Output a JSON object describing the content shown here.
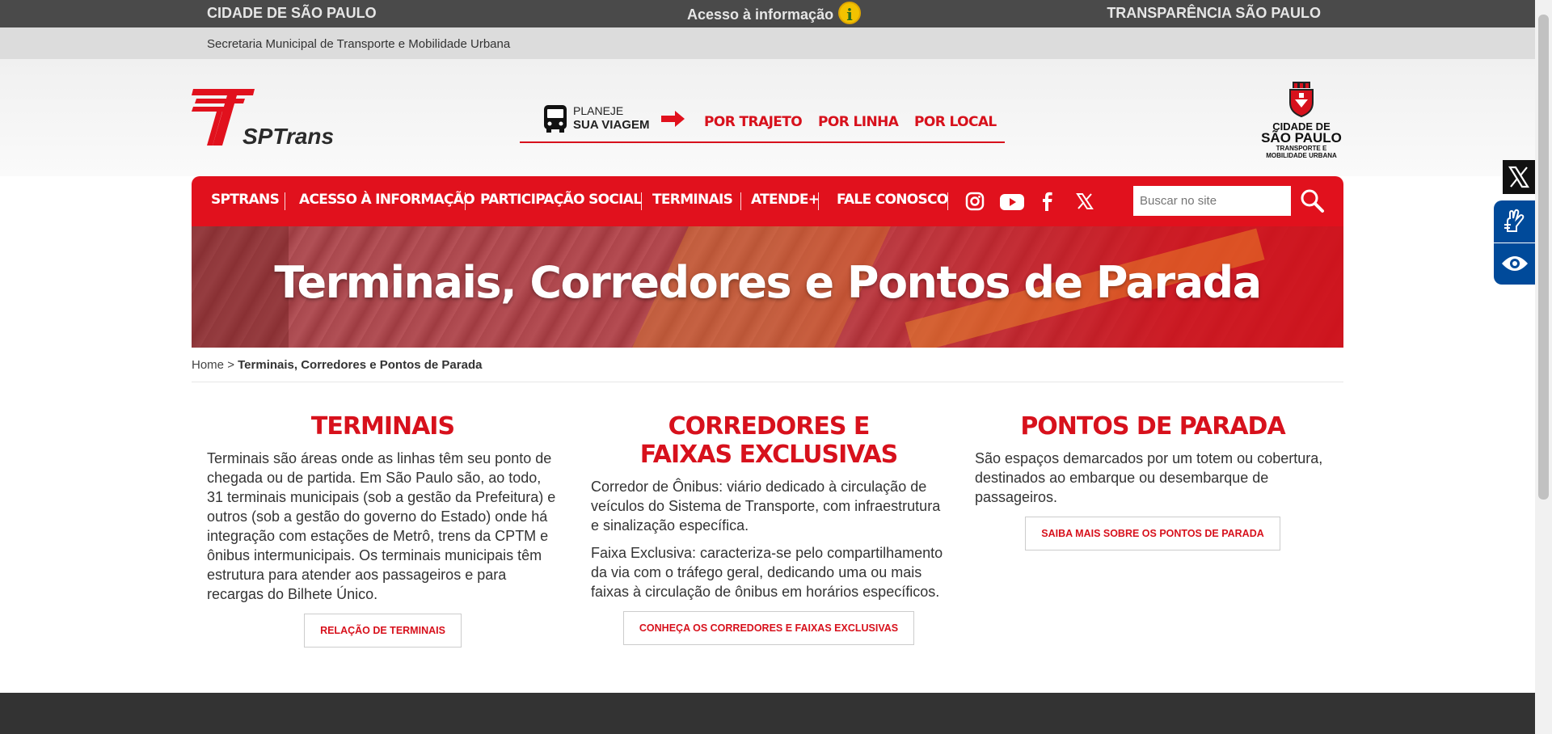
{
  "gov_bar": {
    "left": "CIDADE DE SÃO PAULO",
    "center": "Acesso à informação",
    "right": "TRANSPARÊNCIA SÃO PAULO"
  },
  "secretaria": "Secretaria Municipal de Transporte e Mobilidade Urbana",
  "logo": {
    "text": "SPTrans"
  },
  "planeje": {
    "line1": "PLANEJE",
    "line2": "SUA VIAGEM",
    "links": [
      "POR TRAJETO",
      "POR LINHA",
      "POR LOCAL"
    ]
  },
  "crest": {
    "line1": "CIDADE DE",
    "line2": "SÃO PAULO",
    "line3": "TRANSPORTE E",
    "line4": "MOBILIDADE URBANA"
  },
  "nav": {
    "items": [
      "SPTRANS",
      "ACESSO À INFORMAÇÃO",
      "PARTICIPAÇÃO SOCIAL",
      "TERMINAIS",
      "ATENDE+",
      "FALE CONOSCO"
    ],
    "social_icons": [
      "instagram-icon",
      "youtube-icon",
      "facebook-icon",
      "x-icon"
    ],
    "search_placeholder": "Buscar no site"
  },
  "banner": {
    "title": "Terminais, Corredores e Pontos de Parada"
  },
  "breadcrumb": {
    "home": "Home",
    "sep": ">",
    "current": "Terminais, Corredores e Pontos de Parada"
  },
  "columns": [
    {
      "title": "TERMINAIS",
      "paragraphs": [
        "Terminais são áreas onde as linhas têm seu ponto de chegada ou de partida. Em São Paulo são, ao todo, 31 terminais municipais (sob a gestão da Prefeitura) e outros (sob a gestão do governo do Estado) onde há integração com estações de Metrô, trens da CPTM e ônibus intermunicipais. Os terminais municipais têm estrutura para atender aos passageiros e para recargas do Bilhete Único."
      ],
      "button": "RELAÇÃO DE TERMINAIS"
    },
    {
      "title": "CORREDORES E FAIXAS EXCLUSIVAS",
      "paragraphs": [
        "Corredor de Ônibus: viário dedicado à circulação de veículos do Sistema de Transporte, com infraestrutura e sinalização específica.",
        "Faixa Exclusiva: caracteriza-se pelo compartilhamento da via com o tráfego geral, dedicando uma ou mais faixas à circulação de ônibus em horários específicos."
      ],
      "button": "CONHEÇA OS CORREDORES E FAIXAS EXCLUSIVAS"
    },
    {
      "title": "PONTOS DE PARADA",
      "paragraphs": [
        "São espaços demarcados por um totem ou cobertura, destinados ao embarque ou desembarque de passageiros."
      ],
      "button": "SAIBA MAIS SOBRE OS PONTOS DE PARADA"
    }
  ],
  "accessibility": {
    "icons": [
      "x-close-icon",
      "sign-language-icon",
      "eye-icon"
    ]
  },
  "colors": {
    "brand_red": "#e1111d",
    "text_red": "#d7111c",
    "accessibility_blue": "#004a9a"
  }
}
